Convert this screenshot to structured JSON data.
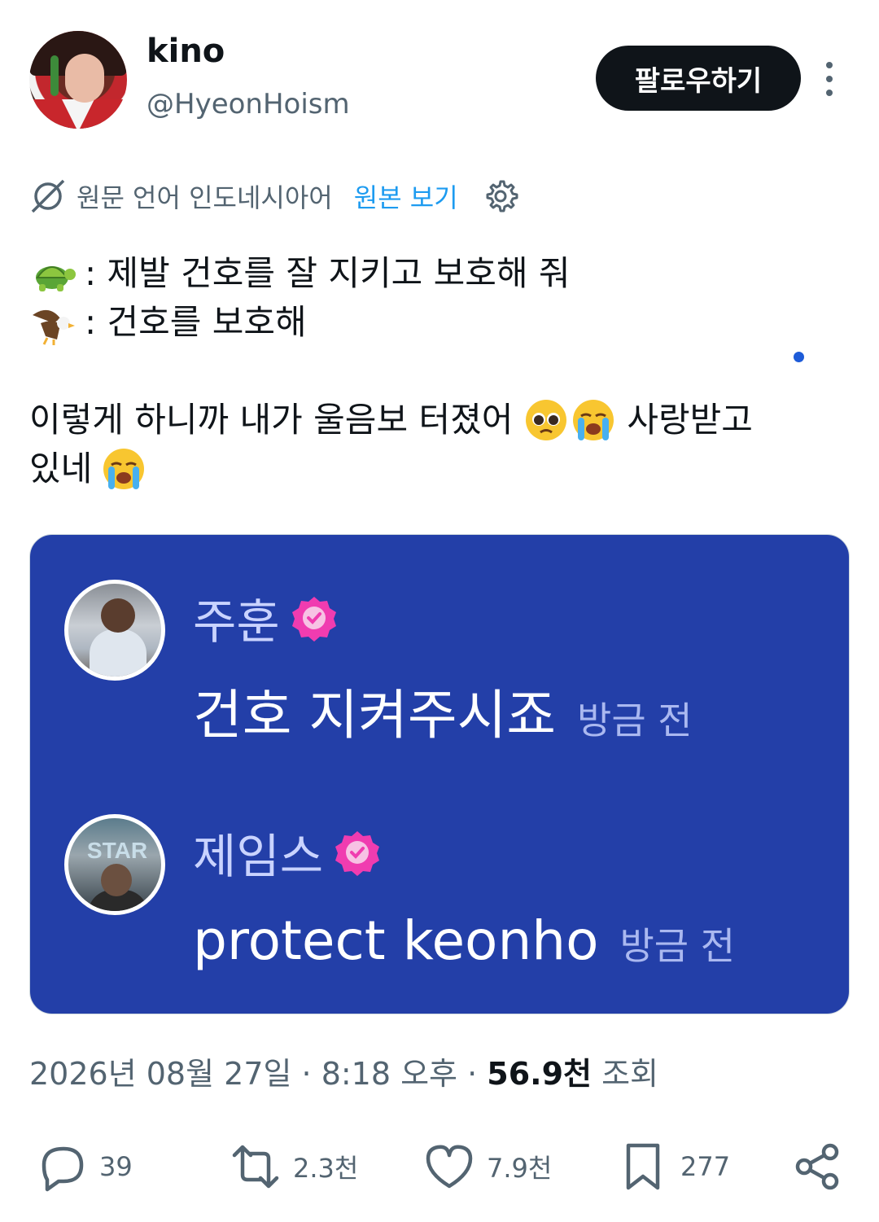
{
  "user": {
    "display_name": "kino",
    "handle": "@HyeonHoism",
    "follow_label": "팔로우하기"
  },
  "translation": {
    "source_text": "원문 언어 인도네시아어",
    "show_original": "원본 보기"
  },
  "tweet": {
    "line1_text": ": 제발 건호를 잘 지키고 보호해 줘",
    "line2_text": ": 건호를 보호해",
    "line3_text_a": "이렇게 하니까 내가 울음보 터졌어",
    "line3_text_b": "사랑받고",
    "line4_text": "있네"
  },
  "media": {
    "comments": [
      {
        "name": "주훈",
        "message": "건호 지켜주시죠",
        "time": "방금 전"
      },
      {
        "name": "제임스",
        "message": "protect keonho",
        "time": "방금 전"
      }
    ],
    "avatar2_sign": "STAR"
  },
  "meta": {
    "date_time": "2026년 08월 27일 · 8:18 오후 · ",
    "views_count": "56.9천",
    "views_label": " 조회"
  },
  "actions": {
    "replies": "39",
    "reposts": "2.3천",
    "likes": "7.9천",
    "bookmarks": "277"
  },
  "colors": {
    "card_bg": "#233fa8",
    "link_blue": "#1d9bf0",
    "badge_pink": "#f03cb0"
  }
}
